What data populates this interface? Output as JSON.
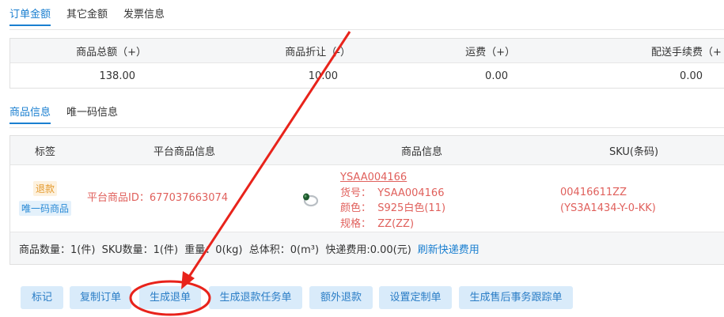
{
  "amount_tabs": [
    "订单金额",
    "其它金额",
    "发票信息"
  ],
  "amounts": {
    "headers": [
      "商品总额（+）",
      "商品折让（-）",
      "运费（+）",
      "配送手续费（+"
    ],
    "values": [
      "138.00",
      "10.00",
      "0.00",
      "0.00"
    ]
  },
  "goods_tabs": [
    "商品信息",
    "唯一码信息"
  ],
  "goods_table": {
    "headers": [
      "标签",
      "平台商品信息",
      "商品信息",
      "SKU(条码)"
    ],
    "row": {
      "tags": [
        "退款",
        "唯一码商品"
      ],
      "platform_id": "平台商品ID：677037663074",
      "product_link": "YSAA004166",
      "product_lines": [
        "货号：  YSAA004166",
        "颜色：  S925白色(11)",
        "规格：  ZZ(ZZ)"
      ],
      "sku_lines": [
        "00416611ZZ",
        "(YS3A1434-Y-0-KK)"
      ],
      "image_icon": "ring-icon"
    },
    "summary_text": "商品数量：1(件)  SKU数量：1(件)  重量：0(kg)  总体积：0(m³)  快递费用:0.00(元)",
    "summary_link": "刷新快递费用"
  },
  "actions": [
    "标记",
    "复制订单",
    "生成退单",
    "生成退款任务单",
    "额外退款",
    "设置定制单",
    "生成售后事务跟踪单"
  ],
  "colors": {
    "accent": "#1a7fd0",
    "annotation": "#e8231b",
    "product_text": "#e0605c"
  }
}
